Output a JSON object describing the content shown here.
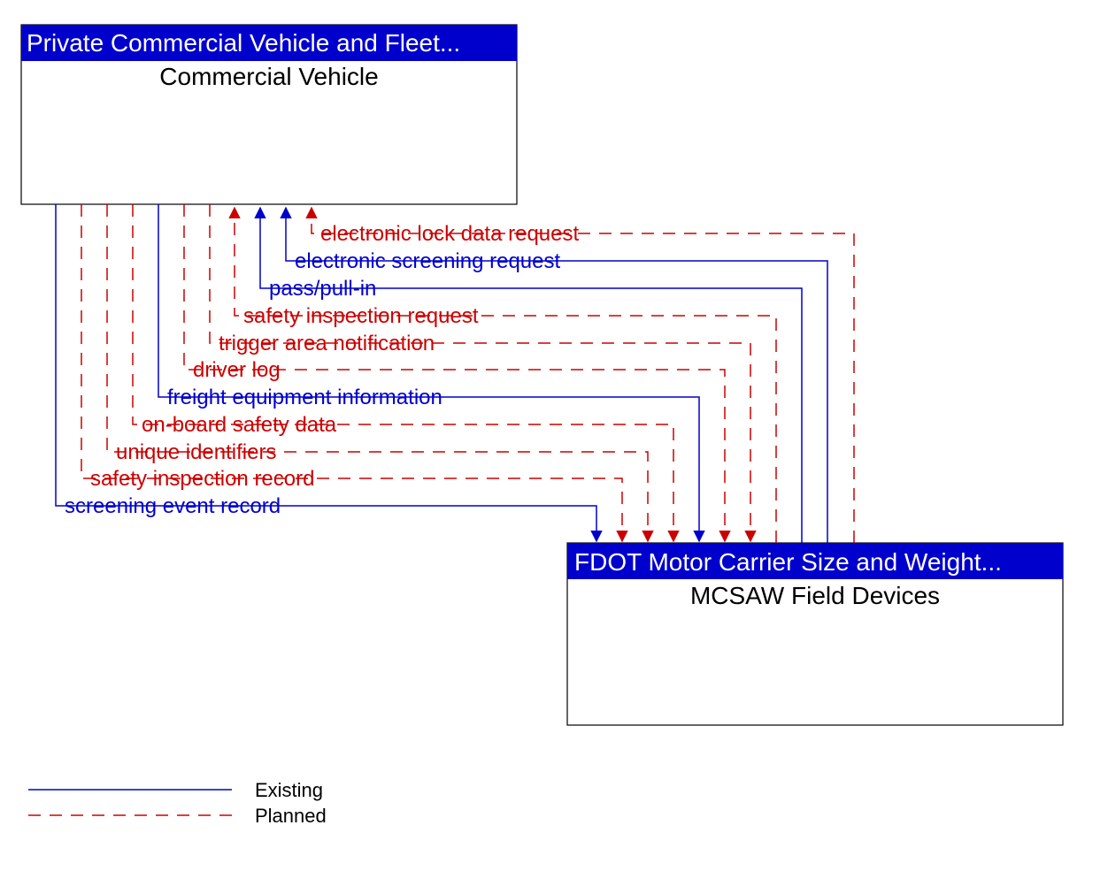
{
  "nodes": {
    "cv": {
      "header": "Private Commercial Vehicle and Fleet...",
      "title": "Commercial Vehicle"
    },
    "mcsaw": {
      "header": "FDOT Motor Carrier Size and Weight...",
      "title": "MCSAW Field Devices"
    }
  },
  "flows": [
    {
      "label": "electronic lock data request",
      "status": "planned",
      "dir": "cv_from_mcsaw"
    },
    {
      "label": "electronic screening request",
      "status": "existing",
      "dir": "cv_from_mcsaw"
    },
    {
      "label": "pass/pull-in",
      "status": "existing",
      "dir": "cv_from_mcsaw"
    },
    {
      "label": "safety inspection request",
      "status": "planned",
      "dir": "cv_from_mcsaw"
    },
    {
      "label": "trigger area notification",
      "status": "planned",
      "dir": "mcsaw_from_cv"
    },
    {
      "label": "driver log",
      "status": "planned",
      "dir": "mcsaw_from_cv"
    },
    {
      "label": "freight equipment information",
      "status": "existing",
      "dir": "mcsaw_from_cv"
    },
    {
      "label": "on-board safety data",
      "status": "planned",
      "dir": "mcsaw_from_cv"
    },
    {
      "label": "unique identifiers",
      "status": "planned",
      "dir": "mcsaw_from_cv"
    },
    {
      "label": "safety inspection record",
      "status": "planned",
      "dir": "mcsaw_from_cv"
    },
    {
      "label": "screening event record",
      "status": "existing",
      "dir": "mcsaw_from_cv"
    }
  ],
  "legend": {
    "existing": "Existing",
    "planned": "Planned"
  }
}
